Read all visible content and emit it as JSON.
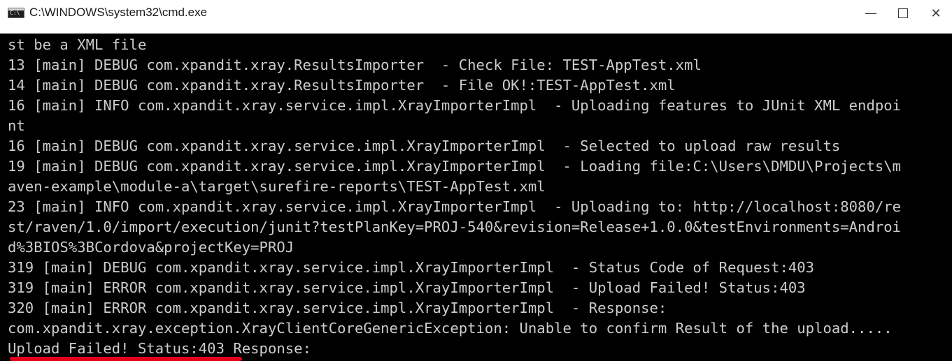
{
  "window": {
    "title": "C:\\WINDOWS\\system32\\cmd.exe",
    "icon": "cmd-icon",
    "icon_text": "C:\\"
  },
  "controls": {
    "minimize": "minimize-icon",
    "maximize": "maximize-icon",
    "close": "close-icon",
    "close_glyph": "✕"
  },
  "console": {
    "lines": [
      "st be a XML file",
      "13 [main] DEBUG com.xpandit.xray.ResultsImporter  - Check File: TEST-AppTest.xml",
      "14 [main] DEBUG com.xpandit.xray.ResultsImporter  - File OK!:TEST-AppTest.xml",
      "16 [main] INFO com.xpandit.xray.service.impl.XrayImporterImpl  - Uploading features to JUnit XML endpoi",
      "nt",
      "16 [main] DEBUG com.xpandit.xray.service.impl.XrayImporterImpl  - Selected to upload raw results",
      "19 [main] DEBUG com.xpandit.xray.service.impl.XrayImporterImpl  - Loading file:C:\\Users\\DMDU\\Projects\\m",
      "aven-example\\module-a\\target\\surefire-reports\\TEST-AppTest.xml",
      "23 [main] INFO com.xpandit.xray.service.impl.XrayImporterImpl  - Uploading to: http://localhost:8080/re",
      "st/raven/1.0/import/execution/junit?testPlanKey=PROJ-540&revision=Release+1.0.0&testEnvironments=Androi",
      "d%3BIOS%3BCordova&projectKey=PROJ",
      "319 [main] DEBUG com.xpandit.xray.service.impl.XrayImporterImpl  - Status Code of Request:403",
      "319 [main] ERROR com.xpandit.xray.service.impl.XrayImporterImpl  - Upload Failed! Status:403",
      "320 [main] ERROR com.xpandit.xray.service.impl.XrayImporterImpl  - Response:",
      "com.xpandit.xray.exception.XrayClientCoreGenericException: Unable to confirm Result of the upload.....",
      "Upload Failed! Status:403 Response:"
    ]
  },
  "colors": {
    "console_background": "#000000",
    "console_text": "#cccccc",
    "highlight_underline": "#e3001b",
    "titlebar_background": "#ffffff"
  }
}
